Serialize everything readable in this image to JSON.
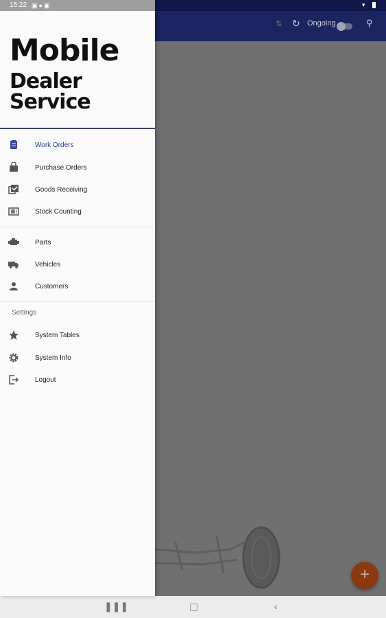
{
  "status": {
    "time": "15:22"
  },
  "appbar": {
    "ongoing_label": "Ongoing"
  },
  "drawer": {
    "brand_line1": "Mobile",
    "brand_line2": "Dealer Service",
    "groups": [
      {
        "items": [
          {
            "label": "Work Orders",
            "icon": "clipboard-icon",
            "active": true
          },
          {
            "label": "Purchase Orders",
            "icon": "shopping-bag-icon"
          },
          {
            "label": "Goods Receiving",
            "icon": "checklist-icon"
          },
          {
            "label": "Stock Counting",
            "icon": "barcode-icon"
          }
        ]
      },
      {
        "items": [
          {
            "label": "Parts",
            "icon": "engine-icon"
          },
          {
            "label": "Vehicles",
            "icon": "truck-icon"
          },
          {
            "label": "Customers",
            "icon": "person-icon"
          }
        ]
      }
    ],
    "settings": {
      "title": "Settings",
      "items": [
        {
          "label": "System Tables",
          "icon": "star-icon"
        },
        {
          "label": "System Info",
          "icon": "gear-icon"
        },
        {
          "label": "Logout",
          "icon": "logout-icon"
        }
      ]
    }
  },
  "fab": {
    "label": "+"
  },
  "colors": {
    "primary": "#1b2660",
    "accent": "#8a3a0e",
    "active_text": "#2b3a8c"
  }
}
